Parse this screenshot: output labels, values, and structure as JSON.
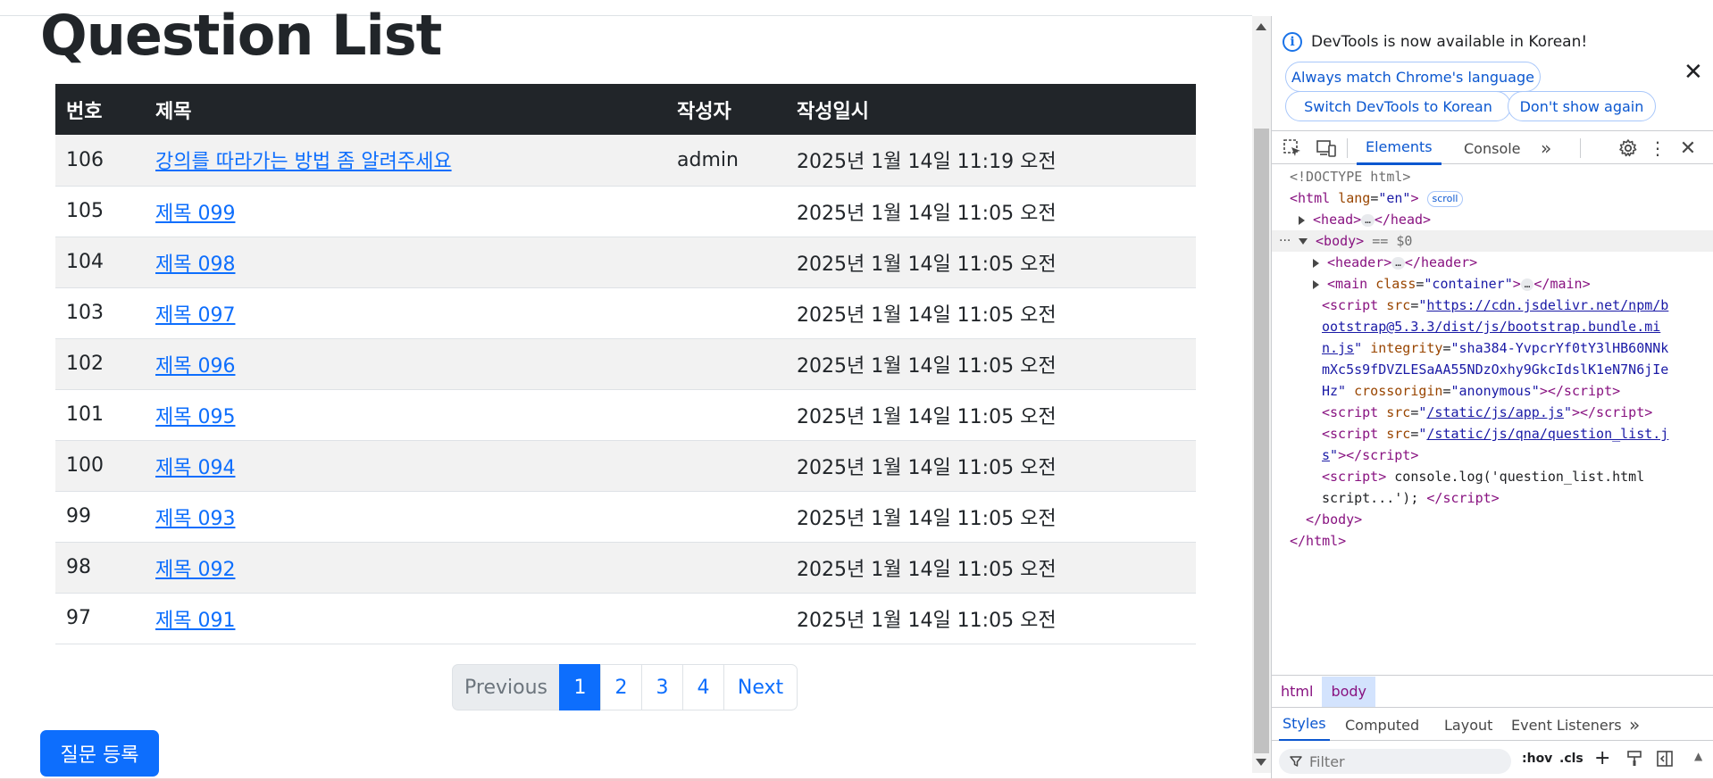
{
  "page": {
    "title": "Question List",
    "table": {
      "headers": [
        "번호",
        "제목",
        "작성자",
        "작성일시"
      ],
      "rows": [
        {
          "num": "106",
          "subject": "강의를 따라가는 방법 좀 알려주세요",
          "author": "admin",
          "date": "2025년 1월 14일 11:19 오전"
        },
        {
          "num": "105",
          "subject": "제목 099",
          "author": "",
          "date": "2025년 1월 14일 11:05 오전"
        },
        {
          "num": "104",
          "subject": "제목 098",
          "author": "",
          "date": "2025년 1월 14일 11:05 오전"
        },
        {
          "num": "103",
          "subject": "제목 097",
          "author": "",
          "date": "2025년 1월 14일 11:05 오전"
        },
        {
          "num": "102",
          "subject": "제목 096",
          "author": "",
          "date": "2025년 1월 14일 11:05 오전"
        },
        {
          "num": "101",
          "subject": "제목 095",
          "author": "",
          "date": "2025년 1월 14일 11:05 오전"
        },
        {
          "num": "100",
          "subject": "제목 094",
          "author": "",
          "date": "2025년 1월 14일 11:05 오전"
        },
        {
          "num": "99",
          "subject": "제목 093",
          "author": "",
          "date": "2025년 1월 14일 11:05 오전"
        },
        {
          "num": "98",
          "subject": "제목 092",
          "author": "",
          "date": "2025년 1월 14일 11:05 오전"
        },
        {
          "num": "97",
          "subject": "제목 091",
          "author": "",
          "date": "2025년 1월 14일 11:05 오전"
        }
      ]
    },
    "pagination": {
      "previous": "Previous",
      "pages": [
        "1",
        "2",
        "3",
        "4"
      ],
      "active_page": "1",
      "next": "Next"
    },
    "register_button": "질문 등록"
  },
  "devtools": {
    "notice": {
      "text": "DevTools is now available in Korean!",
      "btn_always": "Always match Chrome's language",
      "btn_switch": "Switch DevTools to Korean",
      "btn_dont_show": "Don't show again"
    },
    "tabs": {
      "elements": "Elements",
      "console": "Console",
      "more": "»"
    },
    "dom": {
      "doctype": "<!DOCTYPE html>",
      "html_open_tag": "<html",
      "html_lang_attr": "lang",
      "html_lang_val": "\"en\"",
      "scroll_badge": "scroll",
      "head_open": "<head>",
      "head_close": "</head>",
      "body_open": "<body>",
      "body_eq": "== $0",
      "header_open": "<header>",
      "header_close": "</header>",
      "main_open": "<main",
      "main_class_attr": "class",
      "main_class_val": "\"container\"",
      "main_close": "</main>",
      "script1_src_l1": "https://cdn.jsdelivr.net/npm/b",
      "script1_src_l2": "ootstrap@5.3.3/dist/js/bootstrap.bundle.mi",
      "script1_src_l3": "n.js",
      "script1_integrity_attr": "integrity",
      "script1_integrity_l1": "\"sha384-YvpcrYf0tY3lHB60NNk",
      "script1_integrity_l2": "mXc5s9fDVZLESaAA55NDzOxhy9GkcIdslK1eN7N6jIe",
      "script1_integrity_l3": "Hz\"",
      "script1_crossorigin_attr": "crossorigin",
      "script1_crossorigin_val": "\"anonymous\"",
      "script2_src": "/static/js/app.js",
      "script3_src_l1": "/static/js/qna/question_list.j",
      "script3_src_l2": "s",
      "script4_code_l1": "console.log('question_list.html",
      "script4_code_l2": "script...');",
      "body_close": "</body>",
      "html_close": "</html>",
      "ellipsis": "…"
    },
    "breadcrumbs": [
      "html",
      "body"
    ],
    "styles_tabs": [
      "Styles",
      "Computed",
      "Layout",
      "Event Listeners",
      "»"
    ],
    "filter_placeholder": "Filter",
    "filter_tools": {
      "hov": ":hov",
      "cls": ".cls",
      "plus": "+"
    }
  }
}
